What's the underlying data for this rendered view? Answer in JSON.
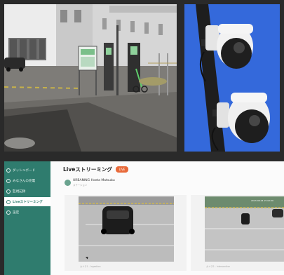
{
  "sidebar": {
    "items": [
      {
        "label": "ダッシュボード",
        "icon": "dashboard-icon"
      },
      {
        "label": "みなさんの充電",
        "icon": "user-icon"
      },
      {
        "label": "監視記録",
        "icon": "record-icon"
      },
      {
        "label": "Liveストリーミング",
        "icon": "live-icon",
        "active": true
      },
      {
        "label": "設定",
        "icon": "settings-icon"
      }
    ]
  },
  "main": {
    "title": "Liveストリーミング",
    "badge": "LIVE",
    "station": {
      "name": "URBANING Hoeta Matsubu",
      "subtitle": "ステーション"
    },
    "cameras": [
      {
        "caption": "カメラ1 - Ingestion"
      },
      {
        "caption": "カメラ2 - Intervention",
        "timestamp": "2023-08-24 15:02:00"
      }
    ]
  },
  "colors": {
    "sidebar": "#2f7c6e",
    "badge": "#e86a3a"
  }
}
